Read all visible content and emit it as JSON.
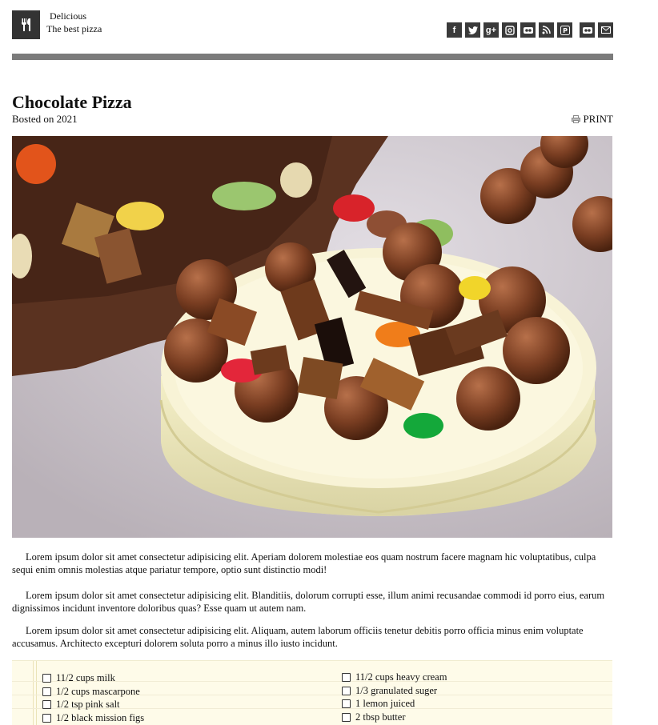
{
  "site": {
    "name": "Delicious",
    "tagline": "The best pizza"
  },
  "social_icons": [
    "facebook-icon",
    "twitter-icon",
    "google-plus-icon",
    "instagram-icon",
    "flickr-icon",
    "rss-icon",
    "pinterest-icon",
    "flickr-icon",
    "email-icon"
  ],
  "article": {
    "title": "Chocolate Pizza",
    "posted": "Bosted on 2021",
    "print_label": "PRINT",
    "paragraphs": [
      "Lorem ipsum dolor sit amet consectetur adipisicing elit. Aperiam dolorem molestiae eos quam nostrum facere magnam hic voluptatibus, culpa sequi enim omnis molestias atque pariatur tempore, optio sunt distinctio modi!",
      "Lorem ipsum dolor sit amet consectetur adipisicing elit. Blanditiis, dolorum corrupti esse, illum animi recusandae commodi id porro eius, earum dignissimos incidunt inventore doloribus quas? Esse quam ut autem nam.",
      "Lorem ipsum dolor sit amet consectetur adipisicing elit. Aliquam, autem laborum officiis tenetur debitis porro officia minus enim voluptate accusamus. Architecto excepturi dolorem soluta porro a minus illo iusto incidunt."
    ]
  },
  "ingredients": {
    "left": [
      "11/2 cups milk",
      "1/2 cups mascarpone",
      "1/2 tsp pink salt",
      "1/2 black mission figs"
    ],
    "right": [
      "11/2 cups heavy cream",
      "1/3 granulated suger",
      "1 lemon juiced",
      "2 tbsp butter"
    ]
  },
  "colors": {
    "bar": "#7b7b7b",
    "icon_bg": "#3a3a3a",
    "ingredients_bg": "#fefbe9"
  }
}
